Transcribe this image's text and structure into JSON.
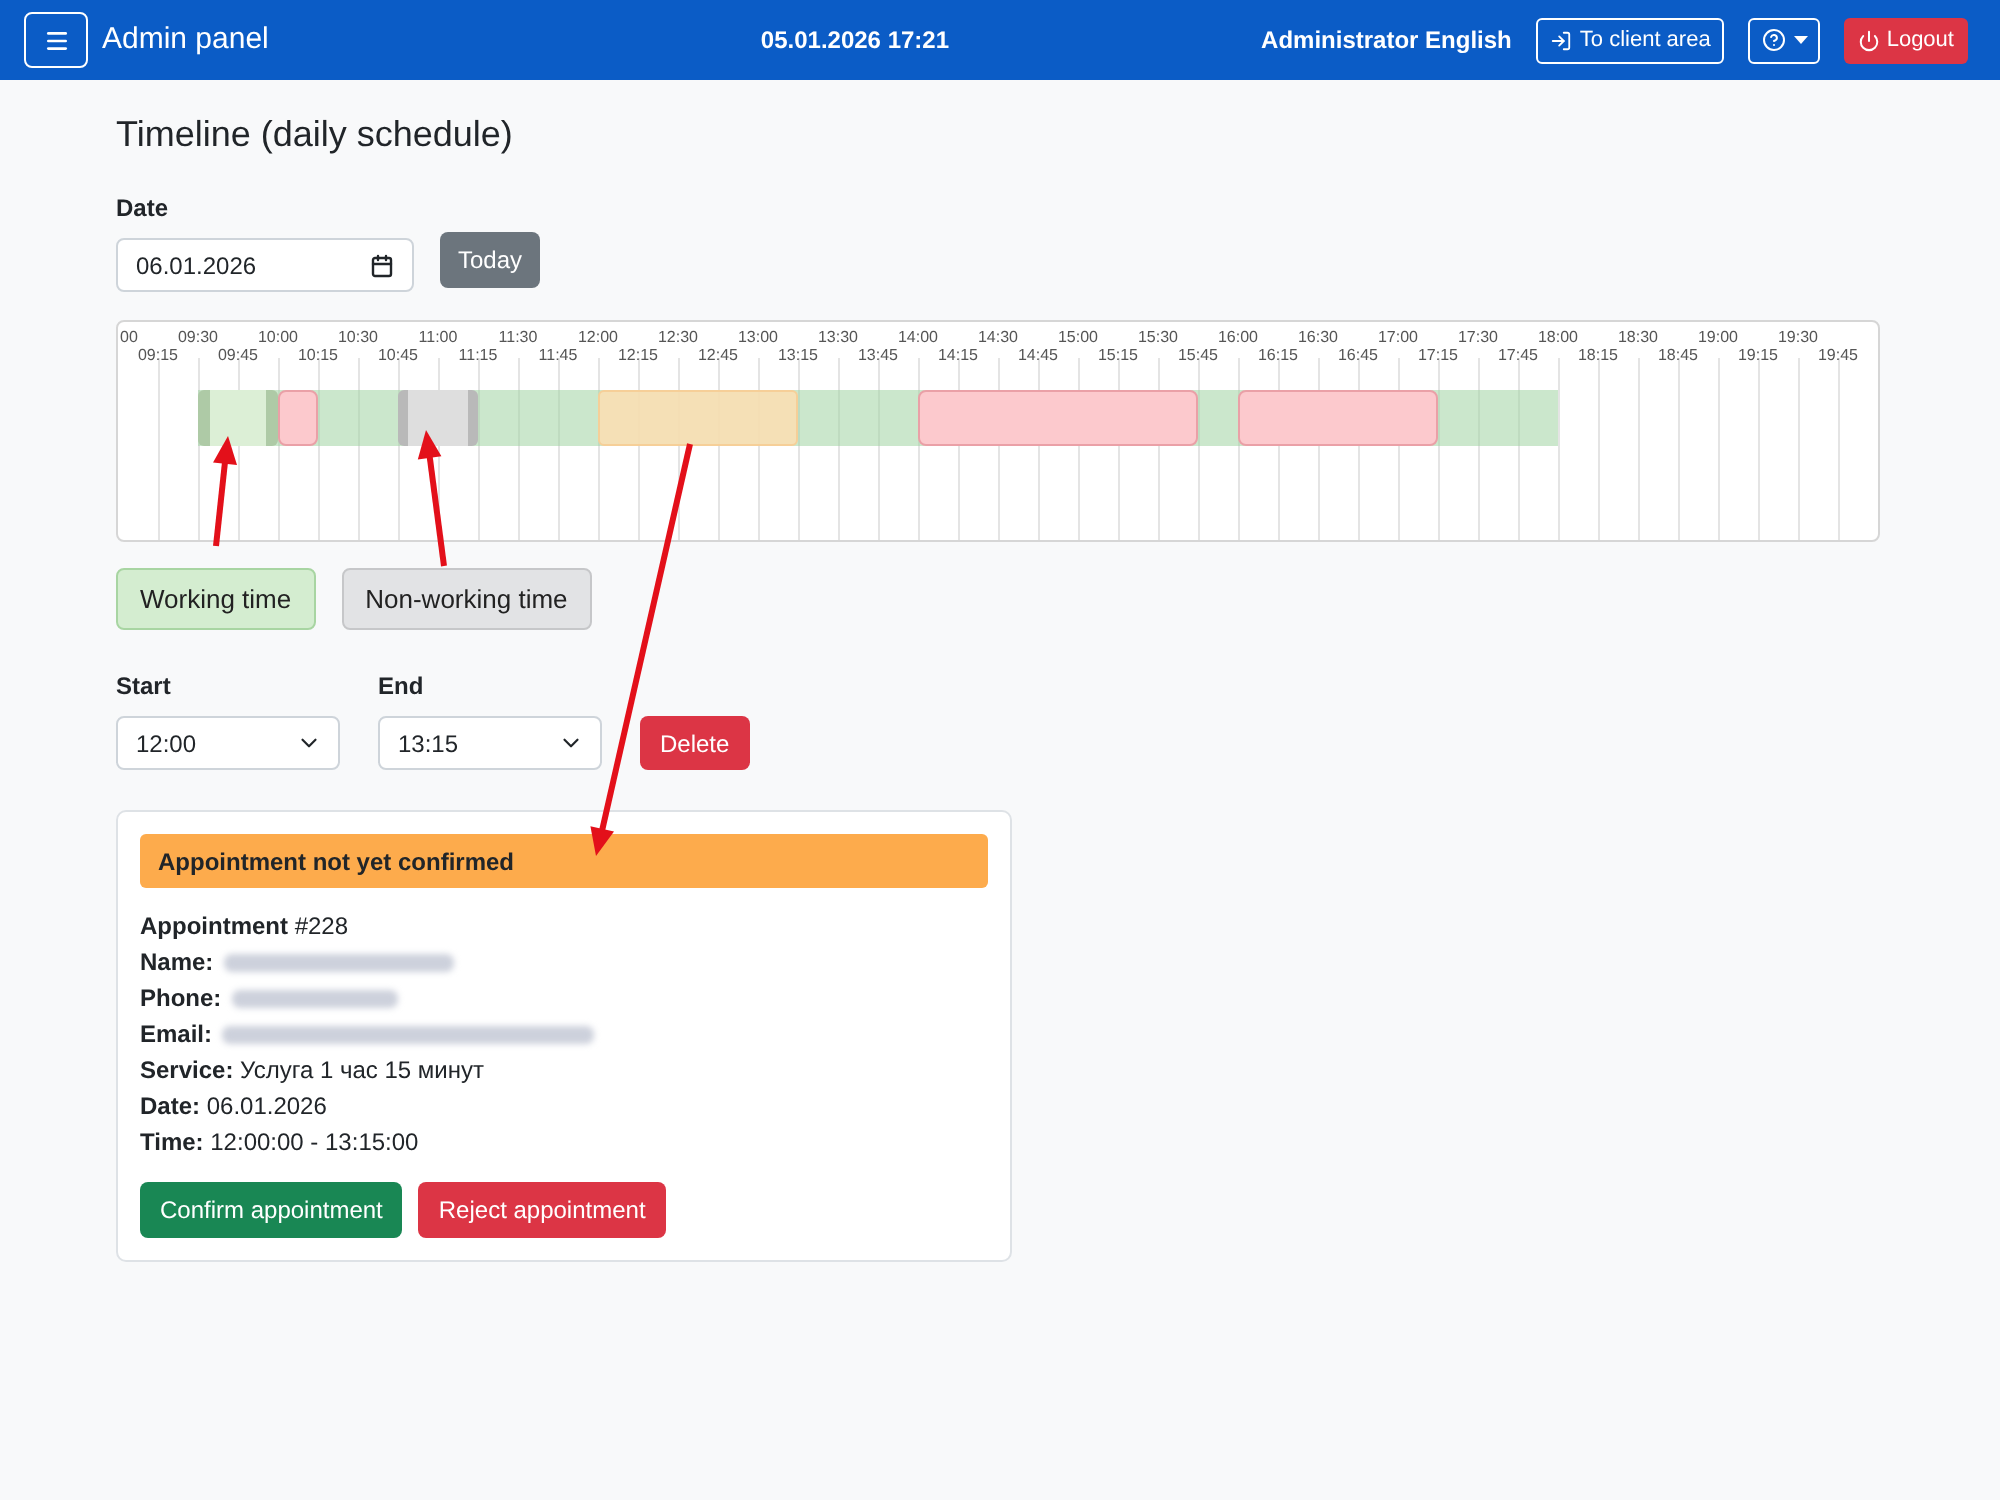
{
  "navbar": {
    "title": "Admin panel",
    "datetime": "05.01.2026 17:21",
    "user": "Administrator English",
    "buttons": [
      {
        "kind": "client",
        "label": "To client area"
      },
      {
        "kind": "help"
      },
      {
        "kind": "logout",
        "label": "Logout"
      }
    ]
  },
  "page": {
    "title": "Timeline (daily schedule)"
  },
  "date_picker": {
    "label": "Date",
    "value": "06.01.2026",
    "today_button": "Today"
  },
  "timeline": {
    "slots": [
      {
        "tick": "00",
        "kind": "closed"
      },
      {
        "tick": "09:15",
        "kind": "closed"
      },
      {
        "tick": "09:30",
        "kind": "work_interval"
      },
      {
        "tick": "09:45",
        "kind": "work_interval"
      },
      {
        "tick": "10:00",
        "kind": "booking"
      },
      {
        "tick": "10:15",
        "kind": "work"
      },
      {
        "tick": "10:30",
        "kind": "work"
      },
      {
        "tick": "10:45",
        "kind": "break_interval"
      },
      {
        "tick": "11:00",
        "kind": "break_interval"
      },
      {
        "tick": "11:15",
        "kind": "work"
      },
      {
        "tick": "11:30",
        "kind": "work"
      },
      {
        "tick": "11:45",
        "kind": "work"
      },
      {
        "tick": "12:00",
        "kind": "pending_booking"
      },
      {
        "tick": "12:15",
        "kind": "pending_booking"
      },
      {
        "tick": "12:30",
        "kind": "pending_booking"
      },
      {
        "tick": "12:45",
        "kind": "pending_booking"
      },
      {
        "tick": "13:00",
        "kind": "pending_booking"
      },
      {
        "tick": "13:15",
        "kind": "work"
      },
      {
        "tick": "13:30",
        "kind": "work"
      },
      {
        "tick": "13:45",
        "kind": "work"
      },
      {
        "tick": "14:00",
        "kind": "booking"
      },
      {
        "tick": "14:15",
        "kind": "booking"
      },
      {
        "tick": "14:30",
        "kind": "booking"
      },
      {
        "tick": "14:45",
        "kind": "booking"
      },
      {
        "tick": "15:00",
        "kind": "booking"
      },
      {
        "tick": "15:15",
        "kind": "booking"
      },
      {
        "tick": "15:30",
        "kind": "booking"
      },
      {
        "tick": "15:45",
        "kind": "work"
      },
      {
        "tick": "16:00",
        "kind": "booking"
      },
      {
        "tick": "16:15",
        "kind": "booking"
      },
      {
        "tick": "16:30",
        "kind": "booking"
      },
      {
        "tick": "16:45",
        "kind": "booking"
      },
      {
        "tick": "17:00",
        "kind": "booking"
      },
      {
        "tick": "17:15",
        "kind": "work"
      },
      {
        "tick": "17:30",
        "kind": "work"
      },
      {
        "tick": "17:45",
        "kind": "work"
      },
      {
        "tick": "18:00",
        "kind": "closed"
      },
      {
        "tick": "18:15",
        "kind": "closed"
      },
      {
        "tick": "18:30",
        "kind": "closed"
      },
      {
        "tick": "18:45",
        "kind": "closed"
      },
      {
        "tick": "19:00",
        "kind": "closed"
      },
      {
        "tick": "19:15",
        "kind": "closed"
      },
      {
        "tick": "19:30",
        "kind": "closed"
      },
      {
        "tick": "19:45",
        "kind": "closed"
      }
    ]
  },
  "legend_buttons": [
    {
      "kind": "working",
      "label": "Working time"
    },
    {
      "kind": "non_working",
      "label": "Non-working time"
    }
  ],
  "interval_editor": {
    "start": {
      "label": "Start",
      "value": "12:00"
    },
    "end": {
      "label": "End",
      "value": "13:15"
    },
    "delete_button": "Delete"
  },
  "appointment_card": {
    "status": "Appointment not yet confirmed",
    "details": [
      {
        "label": "Appointment",
        "value": "#228",
        "redacted": false
      },
      {
        "label": "Name:",
        "redacted": true
      },
      {
        "label": "Phone:",
        "redacted": true
      },
      {
        "label": "Email:",
        "redacted": true
      },
      {
        "label": "Service:",
        "value": "Услуга 1 час 15 минут",
        "redacted": false
      },
      {
        "label": "Date:",
        "value": "06.01.2026",
        "redacted": false
      },
      {
        "label": "Time:",
        "value": "12:00:00 - 13:15:00",
        "redacted": false
      }
    ],
    "buttons": [
      {
        "kind": "confirm",
        "label": "Confirm appointment"
      },
      {
        "kind": "reject",
        "label": "Reject appointment"
      }
    ]
  }
}
